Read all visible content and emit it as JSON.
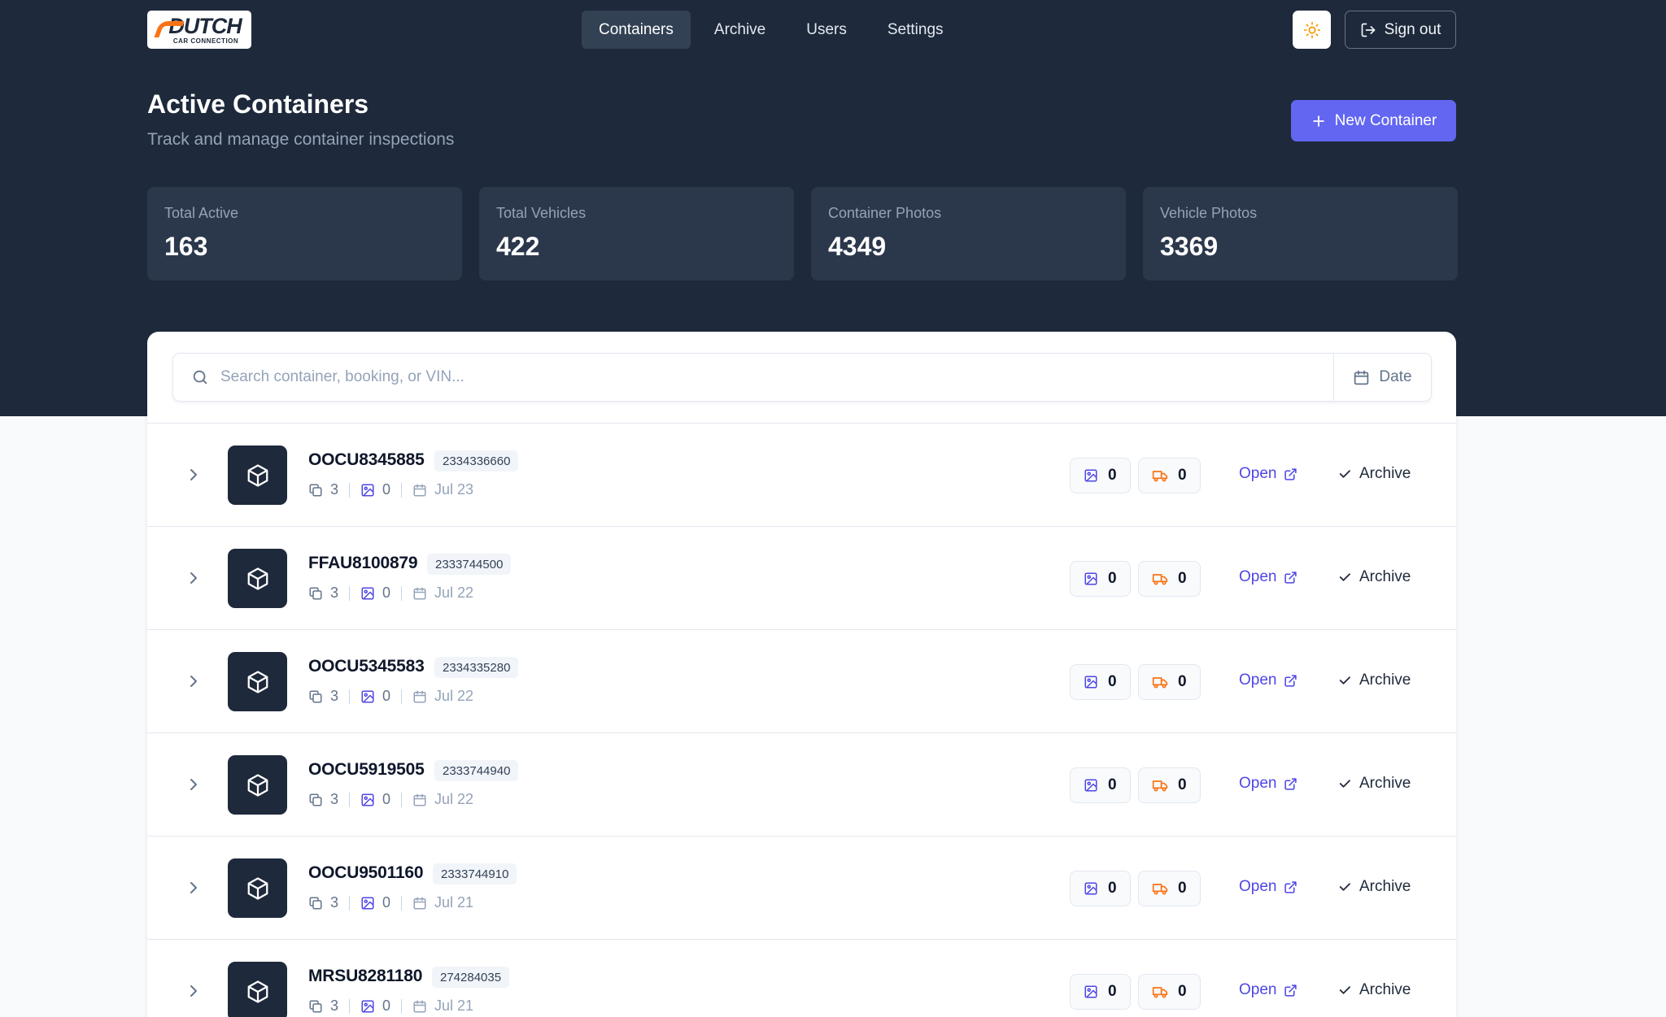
{
  "brand": {
    "name": "DUTCH",
    "tagline": "CAR CONNECTION"
  },
  "nav": [
    {
      "label": "Containers",
      "active": true
    },
    {
      "label": "Archive",
      "active": false
    },
    {
      "label": "Users",
      "active": false
    },
    {
      "label": "Settings",
      "active": false
    }
  ],
  "header": {
    "theme_icon": "sun-icon",
    "signout_label": "Sign out"
  },
  "page": {
    "title": "Active Containers",
    "subtitle": "Track and manage container inspections",
    "new_button_label": "New Container"
  },
  "stats": [
    {
      "label": "Total Active",
      "value": "163"
    },
    {
      "label": "Total Vehicles",
      "value": "422"
    },
    {
      "label": "Container Photos",
      "value": "4349"
    },
    {
      "label": "Vehicle Photos",
      "value": "3369"
    }
  ],
  "search": {
    "placeholder": "Search container, booking, or VIN...",
    "date_label": "Date"
  },
  "row_actions": {
    "open_label": "Open",
    "archive_label": "Archive"
  },
  "colors": {
    "hero_bg": "#1e293b",
    "accent": "#6366f1",
    "vehicle_icon": "#f97316"
  },
  "containers": [
    {
      "id": "OOCU8345885",
      "booking": "2334336660",
      "vehicles": "3",
      "photos": "0",
      "date": "Jul 23",
      "container_photos": "0",
      "vehicle_photos": "0"
    },
    {
      "id": "FFAU8100879",
      "booking": "2333744500",
      "vehicles": "3",
      "photos": "0",
      "date": "Jul 22",
      "container_photos": "0",
      "vehicle_photos": "0"
    },
    {
      "id": "OOCU5345583",
      "booking": "2334335280",
      "vehicles": "3",
      "photos": "0",
      "date": "Jul 22",
      "container_photos": "0",
      "vehicle_photos": "0"
    },
    {
      "id": "OOCU5919505",
      "booking": "2333744940",
      "vehicles": "3",
      "photos": "0",
      "date": "Jul 22",
      "container_photos": "0",
      "vehicle_photos": "0"
    },
    {
      "id": "OOCU9501160",
      "booking": "2333744910",
      "vehicles": "3",
      "photos": "0",
      "date": "Jul 21",
      "container_photos": "0",
      "vehicle_photos": "0"
    },
    {
      "id": "MRSU8281180",
      "booking": "274284035",
      "vehicles": "3",
      "photos": "0",
      "date": "Jul 21",
      "container_photos": "0",
      "vehicle_photos": "0"
    }
  ]
}
